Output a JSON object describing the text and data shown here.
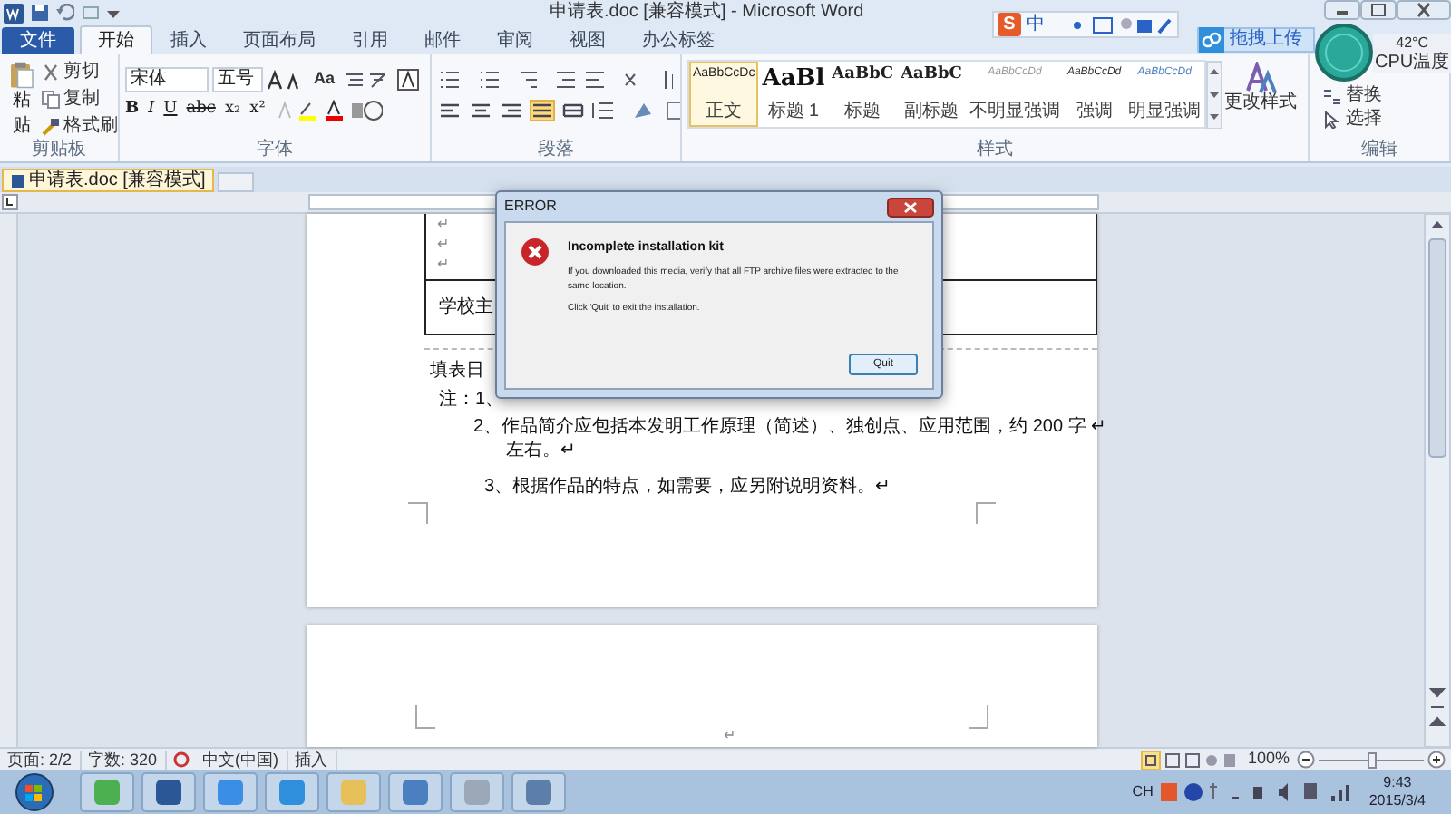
{
  "window": {
    "title": "申请表.doc [兼容模式] - Microsoft Word"
  },
  "ime_toolbar": {
    "logo": "S",
    "label": "中"
  },
  "cloud_upload": {
    "label": "拖拽上传"
  },
  "cpu_widget": {
    "temperature": "42°C",
    "label": "CPU温度"
  },
  "tabs": [
    {
      "label": "文件",
      "kind": "file",
      "selected": false
    },
    {
      "label": "开始",
      "kind": "tab",
      "selected": true
    },
    {
      "label": "插入",
      "kind": "tab",
      "selected": false
    },
    {
      "label": "页面布局",
      "kind": "tab",
      "selected": false
    },
    {
      "label": "引用",
      "kind": "tab",
      "selected": false
    },
    {
      "label": "邮件",
      "kind": "tab",
      "selected": false
    },
    {
      "label": "审阅",
      "kind": "tab",
      "selected": false
    },
    {
      "label": "视图",
      "kind": "tab",
      "selected": false
    },
    {
      "label": "办公标签",
      "kind": "tab",
      "selected": false
    }
  ],
  "ribbon": {
    "clipboard": {
      "group": "剪贴板",
      "paste": "粘贴",
      "items": [
        "剪切",
        "复制",
        "格式刷"
      ]
    },
    "font": {
      "group": "字体",
      "family": "宋体",
      "size": "五号",
      "case_button": "Aa",
      "format_buttons": [
        "B",
        "I",
        "U",
        "abc",
        "x₂",
        "x²"
      ]
    },
    "paragraph": {
      "group": "段落",
      "alignments": [
        {
          "kind": "left",
          "selected": false
        },
        {
          "kind": "center",
          "selected": false
        },
        {
          "kind": "right",
          "selected": false
        },
        {
          "kind": "justify",
          "selected": true
        },
        {
          "kind": "distributed",
          "selected": false
        }
      ]
    },
    "styles": {
      "group": "样式",
      "change_styles": "更改样式",
      "items": [
        {
          "preview": "AaBbCcDc",
          "label": "正文",
          "kind": "normal",
          "selected": true
        },
        {
          "preview": "AaBl",
          "label": "标题 1",
          "kind": "heading1",
          "selected": false
        },
        {
          "preview": "AaBbC",
          "label": "标题",
          "kind": "title",
          "selected": false
        },
        {
          "preview": "AaBbC",
          "label": "副标题",
          "kind": "subtitle",
          "selected": false
        },
        {
          "preview": "AaBbCcDd",
          "label": "不明显强调",
          "kind": "subtle",
          "selected": false
        },
        {
          "preview": "AaBbCcDd",
          "label": "强调",
          "kind": "emphasis",
          "selected": false
        },
        {
          "preview": "AaBbCcDd",
          "label": "明显强调",
          "kind": "intense",
          "selected": false
        }
      ]
    },
    "editing": {
      "group": "编辑",
      "items": [
        "替换",
        "选择"
      ]
    }
  },
  "document_tabs": [
    {
      "label": "申请表.doc [兼容模式]",
      "selected": true
    }
  ],
  "document": {
    "table_cell": "学校主",
    "table_marks": [
      "↵",
      "↵",
      "↵"
    ],
    "lines": [
      {
        "kind": "date",
        "text": "填表日"
      },
      {
        "kind": "note",
        "text": "注：1、"
      },
      {
        "kind": "item",
        "text": "2、作品简介应包括本发明工作原理（简述）、独创点、应用范围，约 200 字 ↵"
      },
      {
        "kind": "continuation",
        "text": "左右。↵"
      },
      {
        "kind": "item3",
        "text": "3、根据作品的特点，如需要，应另附说明资料。↵"
      }
    ],
    "page2_mark": "↵"
  },
  "dialog": {
    "title": "ERROR",
    "heading": "Incomplete installation kit",
    "message": "If you downloaded this media, verify that all FTP archive files were extracted to the same location.",
    "hint": "Click 'Quit' to exit the installation.",
    "button": "Quit"
  },
  "status_bar": {
    "items": [
      "页面: 2/2",
      "字数: 320",
      "中文(中国)",
      "插入"
    ],
    "zoom": "100%",
    "zoom_slider": {
      "level": 0.5
    }
  },
  "taskbar": {
    "input_indicator": "CH",
    "time": "9:43",
    "date": "2015/3/4"
  }
}
